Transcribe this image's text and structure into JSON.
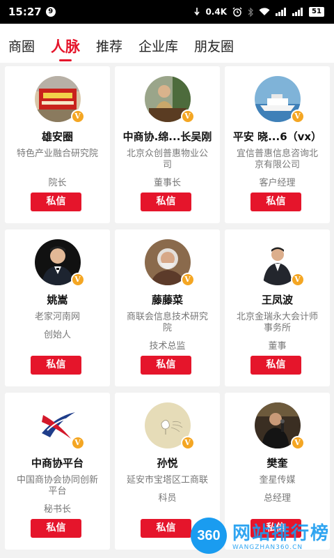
{
  "status_bar": {
    "time": "15:27",
    "notification_count": "9",
    "network_speed": "0.4K",
    "battery": "51"
  },
  "tabs": [
    {
      "label": "商圈",
      "active": false
    },
    {
      "label": "人脉",
      "active": true
    },
    {
      "label": "推荐",
      "active": false
    },
    {
      "label": "企业库",
      "active": false
    },
    {
      "label": "朋友圈",
      "active": false
    }
  ],
  "cards": [
    {
      "name": "雄安圈",
      "org": "特色产业融合研究院",
      "title": "院长",
      "button": "私信",
      "avatar_icon": "red-banner-photo"
    },
    {
      "name": "中商协.绵...长吴刚",
      "org": "北京众创普惠物业公司",
      "title": "董事长",
      "button": "私信",
      "avatar_icon": "man-at-desk-photo"
    },
    {
      "name": "平安 晓...6（vx）",
      "org": "宜信普惠信息咨询北京有限公司",
      "title": "客户经理",
      "button": "私信",
      "avatar_icon": "cruise-ship-photo"
    },
    {
      "name": "姚嵩",
      "org": "老家河南网",
      "title": "创始人",
      "button": "私信",
      "avatar_icon": "man-in-suit-photo"
    },
    {
      "name": "藤藤菜",
      "org": "商联会信息技术研究院",
      "title": "技术总监",
      "button": "私信",
      "avatar_icon": "bearded-man-photo"
    },
    {
      "name": "王凤波",
      "org": "北京金瑞永大会计师事务所",
      "title": "董事",
      "button": "私信",
      "avatar_icon": "man-in-suit-photo"
    },
    {
      "name": "中商协平台",
      "org": "中国商协会协同创新平台",
      "title": "秘书长",
      "button": "私信",
      "avatar_icon": "red-blue-x-logo"
    },
    {
      "name": "孙悦",
      "org": "延安市宝塔区工商联",
      "title": "科员",
      "button": "私信",
      "avatar_icon": "flower-sketch-image"
    },
    {
      "name": "樊奎",
      "org": "奎星传媒",
      "title": "总经理",
      "button": "私信",
      "avatar_icon": "man-with-microphone-photo"
    }
  ],
  "verified_badge": "V",
  "watermark": {
    "badge": "360",
    "text": "网站排行榜",
    "url": "WANGZHAN360.CN"
  },
  "colors": {
    "accent": "#e5152b",
    "badge": "#f4a623",
    "background": "#f2f2f2"
  }
}
